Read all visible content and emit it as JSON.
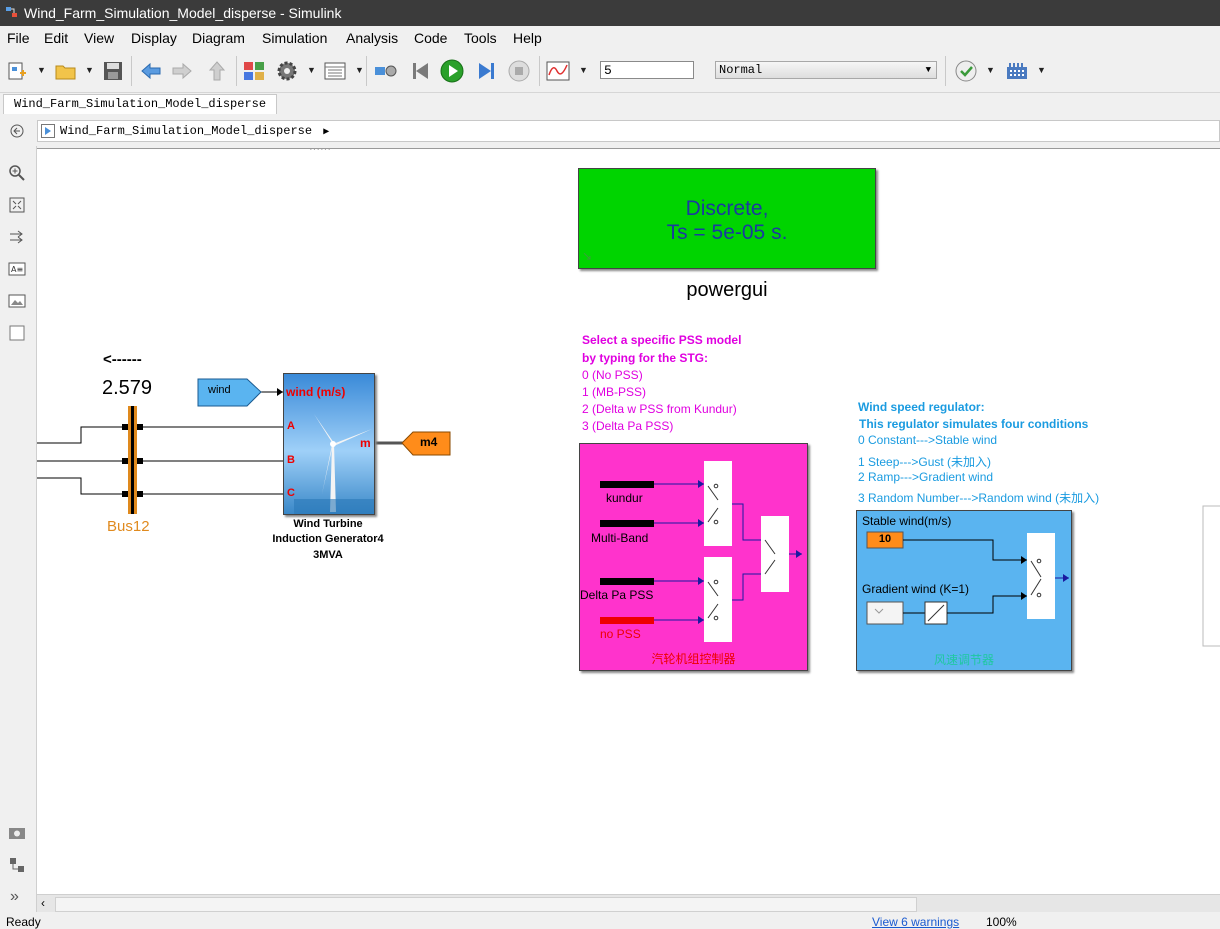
{
  "window": {
    "title": "Wind_Farm_Simulation_Model_disperse - Simulink"
  },
  "menu": [
    {
      "label": "File"
    },
    {
      "label": "Edit"
    },
    {
      "label": "View"
    },
    {
      "label": "Display"
    },
    {
      "label": "Diagram"
    },
    {
      "label": "Simulation"
    },
    {
      "label": "Analysis"
    },
    {
      "label": "Code"
    },
    {
      "label": "Tools"
    },
    {
      "label": "Help"
    }
  ],
  "toolbar": {
    "stop_time": "5",
    "sim_mode": "Normal"
  },
  "tab": {
    "label": "Wind_Farm_Simulation_Model_disperse"
  },
  "breadcrumb": {
    "label": "Wind_Farm_Simulation_Model_disperse"
  },
  "blocks": {
    "powergui": {
      "line1": "Discrete,",
      "line2": "Ts = 5e-05 s.",
      "name": "powergui"
    },
    "bus": {
      "arrow": "<------",
      "value": "2.579",
      "name": "Bus12"
    },
    "wind_tag": "wind",
    "m_tag": "m4",
    "turbine": {
      "in_wind": "wind (m/s)",
      "in_a": "A",
      "in_b": "B",
      "in_c": "C",
      "out_m": "m",
      "name_line1": "Wind Turbine",
      "name_line2": "Induction Generator4",
      "name_line3": "3MVA"
    },
    "pss_note": {
      "l1": "Select a specific PSS model",
      "l2": "by typing for the STG:",
      "l3": "0  (No PSS)",
      "l4": "1  (MB-PSS)",
      "l5": "2  (Delta w PSS from Kundur)",
      "l6": "3  (Delta Pa PSS)"
    },
    "pss_block": {
      "kundur": "kundur",
      "multiband": "Multi-Band",
      "deltapa": "Delta Pa PSS",
      "nopss": "no PSS",
      "name": "汽轮机组控制器"
    },
    "wind_note": {
      "l1": "Wind speed regulator:",
      "l2": "This regulator simulates four conditions",
      "l3": "0  Constant--->Stable wind",
      "l4": "1  Steep--->Gust (未加入)",
      "l5": "2  Ramp--->Gradient wind",
      "l6": "3  Random Number--->Random wind (未加入)"
    },
    "wind_block": {
      "stable": "Stable wind(m/s)",
      "const": "10",
      "gradient": "Gradient wind (K=1)",
      "name": "风速调节器"
    }
  },
  "status": {
    "left": "Ready",
    "warnings": "View 6 warnings",
    "zoom": "100%"
  },
  "colors": {
    "powergui": "#00d400",
    "pss_block": "#ff33cc",
    "wind_block": "#5ab4f0",
    "note_magenta": "#e000e0",
    "note_blue": "#1a9be0",
    "bus_orange": "#e08a1e",
    "tag_orange": "#ff8c1a"
  }
}
